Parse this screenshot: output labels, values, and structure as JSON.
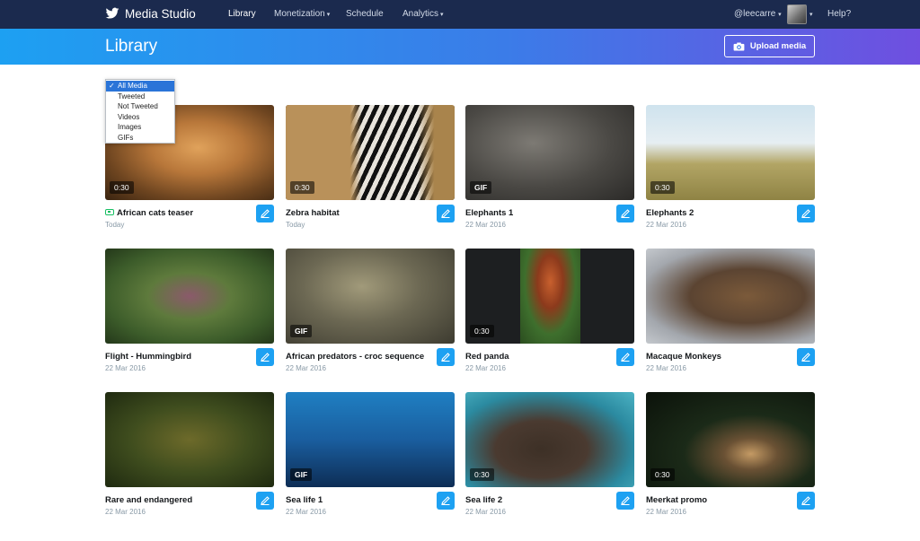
{
  "nav": {
    "brand": "Media Studio",
    "items": [
      {
        "label": "Library",
        "active": true,
        "has_caret": false
      },
      {
        "label": "Monetization",
        "active": false,
        "has_caret": true
      },
      {
        "label": "Schedule",
        "active": false,
        "has_caret": false
      },
      {
        "label": "Analytics",
        "active": false,
        "has_caret": true
      }
    ],
    "user": "@leecarre",
    "help": "Help?"
  },
  "header": {
    "title": "Library",
    "upload_label": "Upload media"
  },
  "filter": {
    "options": [
      "All Media",
      "Tweeted",
      "Not Tweeted",
      "Videos",
      "Images",
      "GIFs"
    ],
    "selected": "All Media"
  },
  "media": [
    {
      "title": "African cats teaser",
      "date": "Today",
      "badge": "0:30",
      "tweeted": true,
      "thumb": "lion"
    },
    {
      "title": "Zebra habitat",
      "date": "Today",
      "badge": "0:30",
      "tweeted": false,
      "thumb": "zebra"
    },
    {
      "title": "Elephants 1",
      "date": "22 Mar 2016",
      "badge": "GIF",
      "tweeted": false,
      "thumb": "elephants-1"
    },
    {
      "title": "Elephants 2",
      "date": "22 Mar 2016",
      "badge": "0:30",
      "tweeted": false,
      "thumb": "elephants-2"
    },
    {
      "title": "Flight - Hummingbird",
      "date": "22 Mar 2016",
      "badge": "",
      "tweeted": false,
      "thumb": "hummingbird"
    },
    {
      "title": "African predators - croc sequence",
      "date": "22 Mar 2016",
      "badge": "GIF",
      "tweeted": false,
      "thumb": "crocodile"
    },
    {
      "title": "Red panda",
      "date": "22 Mar 2016",
      "badge": "0:30",
      "tweeted": false,
      "thumb": "red-panda"
    },
    {
      "title": "Macaque Monkeys",
      "date": "22 Mar 2016",
      "badge": "",
      "tweeted": false,
      "thumb": "macaques"
    },
    {
      "title": "Rare and endangered",
      "date": "22 Mar 2016",
      "badge": "",
      "tweeted": false,
      "thumb": "frog"
    },
    {
      "title": "Sea life 1",
      "date": "22 Mar 2016",
      "badge": "GIF",
      "tweeted": false,
      "thumb": "whale-shark"
    },
    {
      "title": "Sea life 2",
      "date": "22 Mar 2016",
      "badge": "0:30",
      "tweeted": false,
      "thumb": "sea-lion"
    },
    {
      "title": "Meerkat promo",
      "date": "22 Mar 2016",
      "badge": "0:30",
      "tweeted": false,
      "thumb": "meerkat"
    }
  ],
  "colors": {
    "nav_bg": "#1b2a4e",
    "accent": "#1da1f2",
    "band_start": "#1da0f2",
    "band_end": "#6f4fe0",
    "tweeted": "#17bf63"
  }
}
